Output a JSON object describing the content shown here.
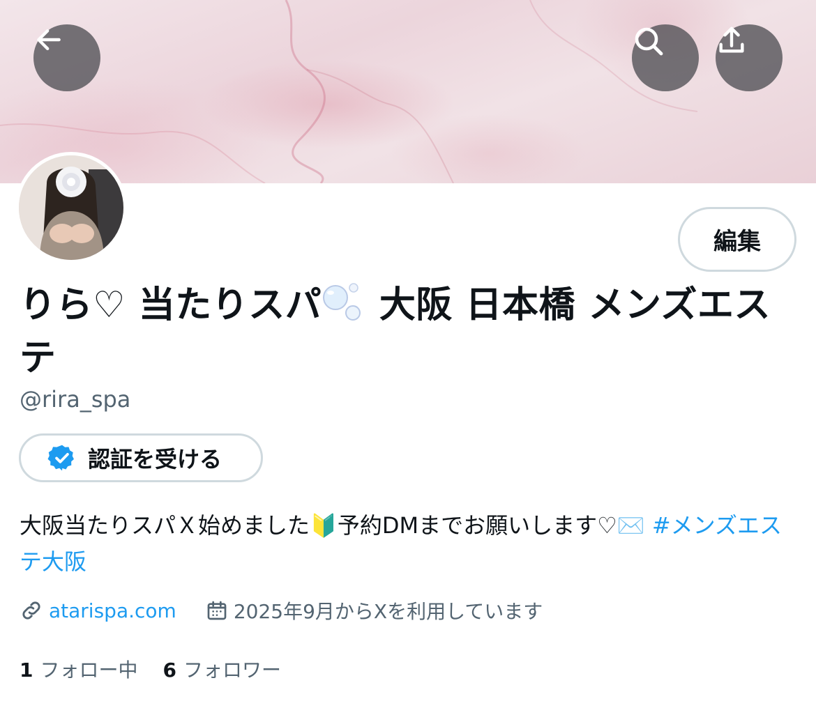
{
  "header": {
    "back_icon": "arrow-left-icon",
    "search_icon": "search-icon",
    "share_icon": "share-icon"
  },
  "profile": {
    "edit_label": "編集",
    "display_name_part1": "りら♡ 当たりスパ",
    "display_name_part2": " 大阪 日本橋 メンズエステ",
    "handle": "@rira_spa",
    "verify_label": "認証を受ける",
    "bio_text": "大阪当たりスパＸ始めました🔰予約DMまでお願いします♡✉️ ",
    "bio_hashtag": "#メンズエステ大阪",
    "website": "atarispa.com",
    "joined": "2025年9月からXを利用しています"
  },
  "stats": {
    "following_count": "1",
    "following_label": "フォロー中",
    "followers_count": "6",
    "followers_label": "フォロワー"
  },
  "colors": {
    "accent": "#1d9bf0",
    "secondary_text": "#536471",
    "border": "#cfd9de"
  }
}
